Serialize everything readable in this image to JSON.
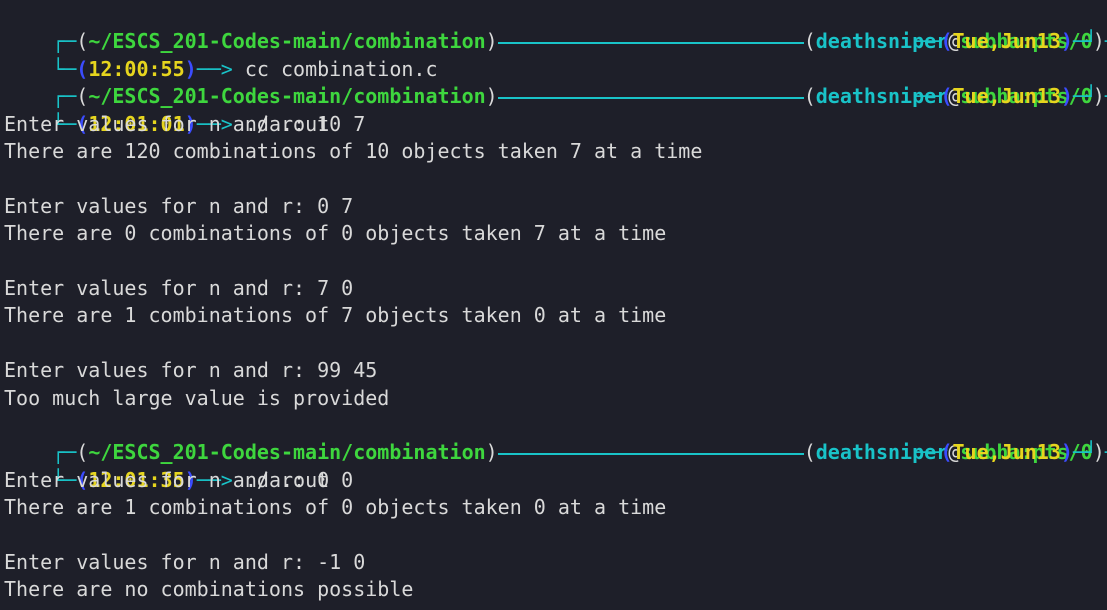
{
  "theme": {
    "background": "#1e1f29",
    "text": "#d9d9d9",
    "cyan": "#19c3c8",
    "blue": "#3b4cff",
    "green": "#3ed63e",
    "yellow": "#e6d51e"
  },
  "prompt": {
    "path": "~/ESCS_201-Codes-main/combination",
    "user": "deathsniper",
    "at": "@",
    "host": "subha:pts/0",
    "date": "Tue,Jun13"
  },
  "sessions": [
    {
      "time": "12:00:55",
      "command": "cc combination.c",
      "output": []
    },
    {
      "time": "12:01:01",
      "command": "./a.out",
      "output": [
        "Enter values for n and r: 10 7",
        "There are 120 combinations of 10 objects taken 7 at a time",
        "",
        "Enter values for n and r: 0 7",
        "There are 0 combinations of 0 objects taken 7 at a time",
        "",
        "Enter values for n and r: 7 0",
        "There are 1 combinations of 7 objects taken 0 at a time",
        "",
        "Enter values for n and r: 99 45",
        "Too much large value is provided"
      ]
    },
    {
      "time": "12:01:35",
      "command": "./a.out",
      "output": [
        "Enter values for n and r: 0 0",
        "There are 1 combinations of 0 objects taken 0 at a time",
        "",
        "Enter values for n and r: -1 0",
        "There are no combinations possible"
      ]
    }
  ]
}
